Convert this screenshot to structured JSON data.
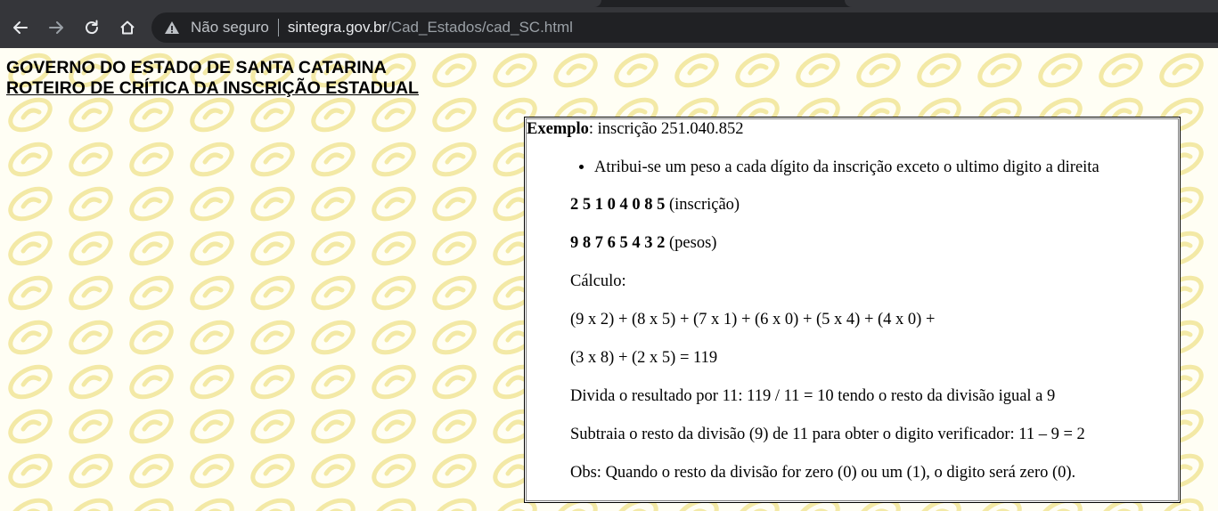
{
  "browser": {
    "security_label": "Não seguro",
    "url_host": "sintegra.gov.br",
    "url_path": "/Cad_Estados/cad_SC.html"
  },
  "page": {
    "title_1": "GOVERNO DO ESTADO DE SANTA CATARINA",
    "title_2": "ROTEIRO DE CRÍTICA DA INSCRIÇÃO ESTADUAL"
  },
  "example": {
    "label": "Exemplo",
    "intro": ": inscrição 251.040.852",
    "bullet": "Atribui-se um peso a cada dígito da inscrição exceto o ultimo digito a direita",
    "digits": "2 5 1 0 4 0 8 5",
    "digits_suffix": " (inscrição)",
    "weights": "9 8 7 6 5 4 3 2",
    "weights_suffix": " (pesos)",
    "calc_label": "Cálculo:",
    "calc_line_1": "(9 x 2) + (8 x 5) + (7 x 1) + (6 x 0) + (5 x 4) + (4 x 0) +",
    "calc_line_2": "(3 x 8) + (2 x 5) = 119",
    "divide_line": "Divida o resultado por 11: 119 / 11 = 10 tendo o resto da divisão igual a 9",
    "subtract_line": "Subtraia o resto da divisão (9) de 11 para obter o digito verificador: 11 – 9 = 2",
    "obs_line": "Obs: Quando o resto da divisão for zero (0) ou um (1), o digito será zero (0)."
  },
  "colors": {
    "chrome_bg": "#35363a",
    "omnibox_bg": "#202124",
    "pattern_color": "#f3e9a6"
  }
}
